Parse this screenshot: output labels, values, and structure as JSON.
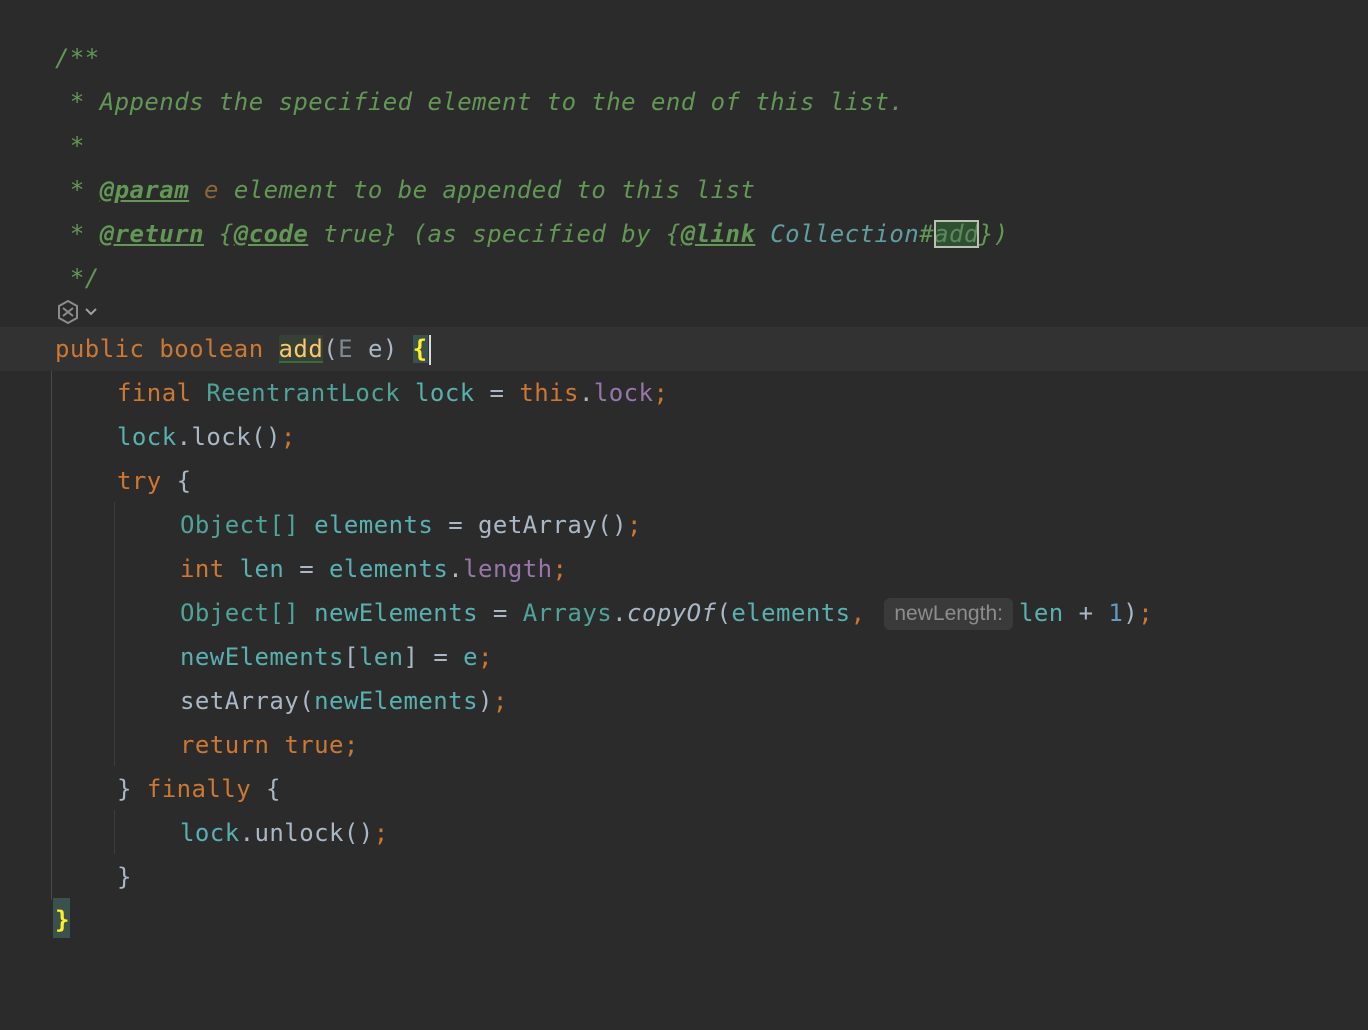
{
  "editor": {
    "javadoc": {
      "open": "/**",
      "summary": " * Appends the specified element to the end of this list.",
      "blank": " *",
      "param_prefix": " * ",
      "param_tag": "@param",
      "param_name": "e",
      "param_desc": " element to be appended to this list",
      "return_prefix": " * ",
      "return_tag": "@return",
      "return_code_open": "{",
      "return_code_tag": "@code",
      "return_code_value": " true}",
      "return_desc": " (as specified by {",
      "return_link_tag": "@link",
      "return_link_target": " Collection",
      "return_link_hash": "#",
      "return_link_member": "add",
      "return_link_close": "})",
      "close": " */"
    },
    "signature": {
      "kw_public": "public",
      "kw_boolean": "boolean",
      "method": "add",
      "paren_open": "(",
      "type": "E",
      "param": "e",
      "paren_close": ")",
      "brace": "{"
    },
    "lines": {
      "l1_final": "final",
      "l1_type": "ReentrantLock",
      "l1_var": "lock",
      "l1_eq": "=",
      "l1_this": "this",
      "l1_dot": ".",
      "l1_field": "lock",
      "l1_semi": ";",
      "l2_var": "lock",
      "l2_call": ".lock()",
      "l2_semi": ";",
      "l3_try": "try",
      "l3_brace": "{",
      "l4_type": "Object[]",
      "l4_var": "elements",
      "l4_eq": "=",
      "l4_call": "getArray()",
      "l4_semi": ";",
      "l5_kw": "int",
      "l5_var": "len",
      "l5_eq": "=",
      "l5_obj": "elements",
      "l5_dot": ".",
      "l5_field": "length",
      "l5_semi": ";",
      "l6_type": "Object[]",
      "l6_var": "newElements",
      "l6_eq": "=",
      "l6_cls": "Arrays",
      "l6_dot": ".",
      "l6_static": "copyOf",
      "l6_po": "(",
      "l6_arg1": "elements",
      "l6_comma": ",",
      "l6_hint": "newLength:",
      "l6_arg2": "len",
      "l6_plus": "+",
      "l6_num": "1",
      "l6_pc": ")",
      "l6_semi": ";",
      "l7_var": "newElements",
      "l7_bo": "[",
      "l7_idx": "len",
      "l7_bc": "]",
      "l7_eq": "=",
      "l7_val": "e",
      "l7_semi": ";",
      "l8_call": "setArray(",
      "l8_arg": "newElements",
      "l8_pc": ")",
      "l8_semi": ";",
      "l9_kw": "return",
      "l9_val": "true",
      "l9_semi": ";",
      "l10_close": "}",
      "l10_finally": "finally",
      "l10_open": "{",
      "l11_var": "lock",
      "l11_call": ".unlock()",
      "l11_semi": ";",
      "l12_close": "}",
      "l13_close": "}"
    },
    "gutter_icon": "ai-assistant-icon",
    "colors": {
      "background": "#2b2b2b",
      "keyword": "#cc7832",
      "comment": "#629755",
      "type": "#4ea39a",
      "field": "#9876aa",
      "brace_highlight": "#ffef28"
    }
  }
}
